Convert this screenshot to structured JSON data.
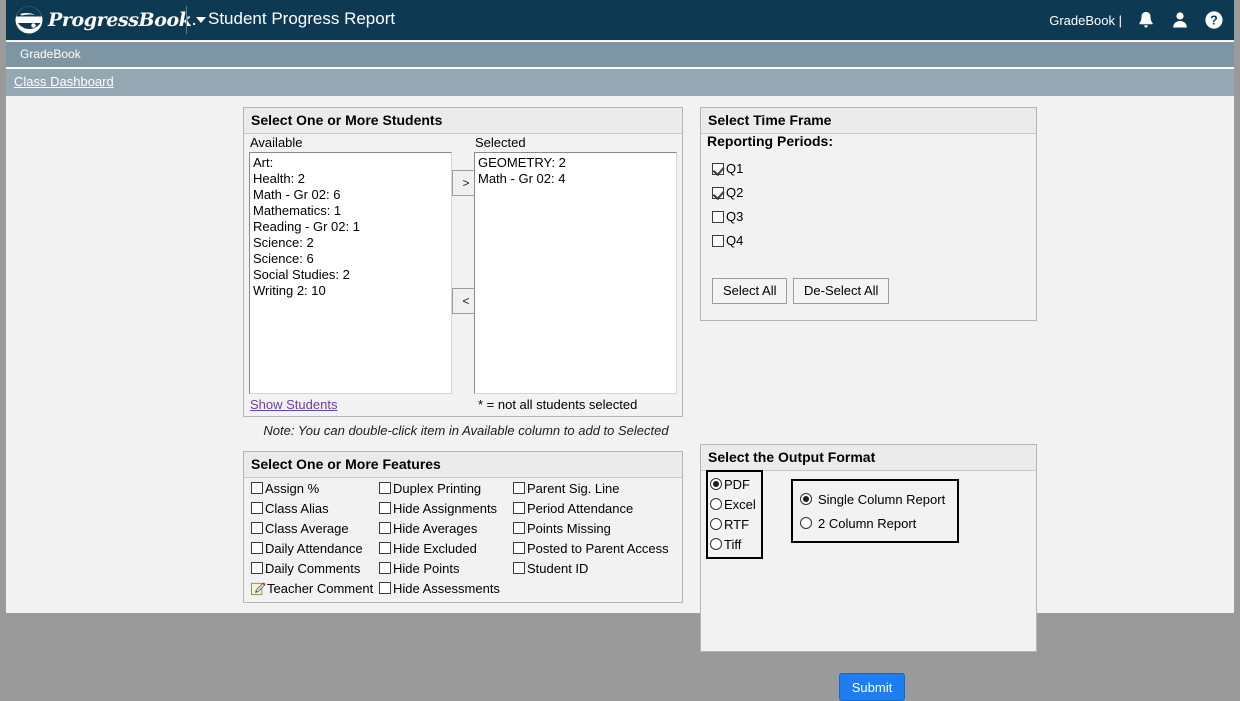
{
  "header": {
    "brand": "ProgressBook",
    "title": "Student Progress Report",
    "account_label": "GradeBook |",
    "icons": [
      "bell-icon",
      "user-icon",
      "help-icon"
    ],
    "background_color": "#0d3a52"
  },
  "subbar": {
    "label": "GradeBook"
  },
  "breadcrumb": {
    "label": "Class Dashboard"
  },
  "students_panel": {
    "title": "Select One or More Students",
    "available_label": "Available",
    "selected_label": "Selected",
    "available": [
      "Art:",
      "Health: 2",
      "Math - Gr 02: 6",
      "Mathematics: 1",
      "Reading - Gr 02: 1",
      "Science: 2",
      "Science: 6",
      "Social Studies: 2",
      "Writing 2: 10"
    ],
    "selected": [
      "GEOMETRY: 2",
      "Math - Gr 02: 4"
    ],
    "add_button": ">",
    "remove_button": "<",
    "show_students_link": "Show Students",
    "legend": "* = not all students selected",
    "note": "Note: You can double-click item in Available column to add to Selected"
  },
  "features_panel": {
    "title": "Select One or More Features",
    "columns": [
      [
        {
          "label": "Assign %",
          "checked": false,
          "control": "checkbox"
        },
        {
          "label": "Class Alias",
          "checked": false,
          "control": "checkbox"
        },
        {
          "label": "Class Average",
          "checked": false,
          "control": "checkbox"
        },
        {
          "label": "Daily Attendance",
          "checked": false,
          "control": "checkbox"
        },
        {
          "label": "Daily Comments",
          "checked": false,
          "control": "checkbox"
        },
        {
          "label": "Teacher Comment",
          "checked": false,
          "control": "note-pencil-icon"
        }
      ],
      [
        {
          "label": "Duplex Printing",
          "checked": false,
          "control": "checkbox"
        },
        {
          "label": "Hide Assignments",
          "checked": false,
          "control": "checkbox"
        },
        {
          "label": "Hide Averages",
          "checked": false,
          "control": "checkbox"
        },
        {
          "label": "Hide Excluded",
          "checked": false,
          "control": "checkbox"
        },
        {
          "label": "Hide Points",
          "checked": false,
          "control": "checkbox"
        },
        {
          "label": "Hide Assessments",
          "checked": false,
          "control": "checkbox"
        }
      ],
      [
        {
          "label": "Parent Sig. Line",
          "checked": false,
          "control": "checkbox"
        },
        {
          "label": "Period Attendance",
          "checked": false,
          "control": "checkbox"
        },
        {
          "label": "Points Missing",
          "checked": false,
          "control": "checkbox"
        },
        {
          "label": "Posted to Parent Access",
          "checked": false,
          "control": "checkbox"
        },
        {
          "label": "Student ID",
          "checked": false,
          "control": "checkbox"
        }
      ]
    ]
  },
  "timeframe_panel": {
    "title": "Select Time Frame",
    "reporting_periods_label": "Reporting Periods:",
    "periods": [
      {
        "label": "Q1",
        "checked": true
      },
      {
        "label": "Q2",
        "checked": true
      },
      {
        "label": "Q3",
        "checked": false
      },
      {
        "label": "Q4",
        "checked": false
      }
    ],
    "select_all": "Select All",
    "deselect_all": "De-Select All"
  },
  "output_panel": {
    "title": "Select the Output Format",
    "formats": [
      {
        "label": "PDF",
        "selected": true
      },
      {
        "label": "Excel",
        "selected": false
      },
      {
        "label": "RTF",
        "selected": false
      },
      {
        "label": "Tiff",
        "selected": false
      }
    ],
    "layouts": [
      {
        "label": "Single Column Report",
        "selected": true
      },
      {
        "label": "2 Column Report",
        "selected": false
      }
    ]
  },
  "submit": {
    "label": "Submit",
    "color": "#1e7ef0"
  }
}
